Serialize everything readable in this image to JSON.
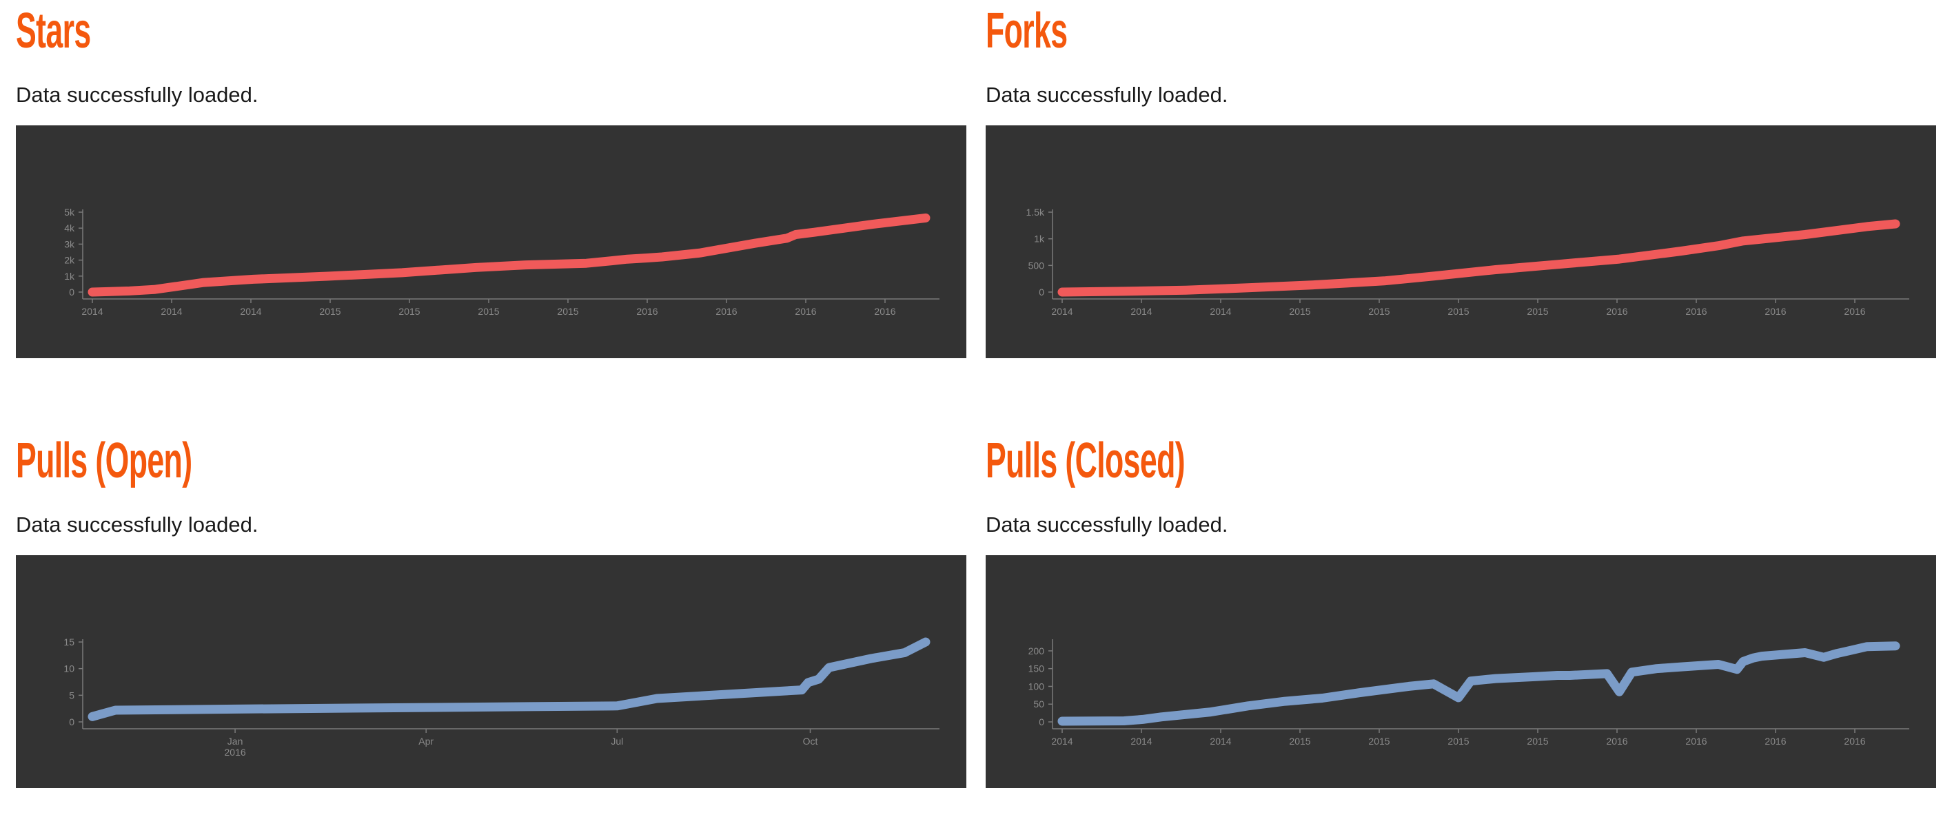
{
  "panels": [
    {
      "id": "stars",
      "title": "Stars",
      "status": "Data successfully loaded.",
      "color": "#f05a5a",
      "chart_data": {
        "type": "line",
        "title": "Stars",
        "xlabel": "",
        "ylabel": "",
        "x_tick_labels": [
          "2014",
          "2014",
          "2014",
          "2015",
          "2015",
          "2015",
          "2015",
          "2016",
          "2016",
          "2016",
          "2016"
        ],
        "y_tick_labels": [
          "0",
          "1k",
          "2k",
          "3k",
          "4k",
          "5k"
        ],
        "y_ticks": [
          0,
          1000,
          2000,
          3000,
          4000,
          5000
        ],
        "ylim": [
          0,
          5000
        ],
        "x": [
          0,
          10,
          30,
          50,
          90,
          130,
          190,
          250,
          310,
          350,
          399,
          420,
          432,
          447,
          460,
          490,
          535,
          561,
          568,
          583,
          630,
          673
        ],
        "y": [
          0,
          20,
          70,
          160,
          600,
          800,
          990,
          1210,
          1540,
          1700,
          1800,
          1960,
          2060,
          2130,
          2200,
          2440,
          3050,
          3370,
          3600,
          3740,
          4240,
          4640
        ],
        "xlim": [
          0,
          673
        ],
        "grid": false,
        "legend": "none"
      }
    },
    {
      "id": "forks",
      "title": "Forks",
      "status": "Data successfully loaded.",
      "color": "#f05a5a",
      "chart_data": {
        "type": "line",
        "title": "Forks",
        "xlabel": "",
        "ylabel": "",
        "x_tick_labels": [
          "2014",
          "2014",
          "2014",
          "2015",
          "2015",
          "2015",
          "2015",
          "2016",
          "2016",
          "2016",
          "2016"
        ],
        "y_tick_labels": [
          "0",
          "500",
          "1k",
          "1.5k"
        ],
        "y_ticks": [
          0,
          500,
          1000,
          1500
        ],
        "ylim": [
          0,
          1500
        ],
        "x": [
          0,
          50,
          100,
          150,
          200,
          230,
          260,
          300,
          350,
          400,
          450,
          500,
          530,
          550,
          600,
          650,
          673
        ],
        "y": [
          0,
          14,
          35,
          80,
          130,
          170,
          210,
          300,
          420,
          520,
          620,
          770,
          870,
          960,
          1080,
          1230,
          1280
        ],
        "xlim": [
          0,
          673
        ],
        "grid": false,
        "legend": "none"
      }
    },
    {
      "id": "pulls-open",
      "title": "Pulls (Open)",
      "status": "Data successfully loaded.",
      "color": "#7b9cc8",
      "chart_data": {
        "type": "line",
        "title": "Pulls (Open)",
        "xlabel": "",
        "ylabel": "",
        "x_tick_labels": [
          "Jan 2016",
          "Apr",
          "Jul",
          "Oct"
        ],
        "y_tick_labels": [
          "0",
          "5",
          "10",
          "15"
        ],
        "y_ticks": [
          0,
          5,
          10,
          15
        ],
        "ylim": [
          0,
          15
        ],
        "x": [
          "2015-10-25",
          "2015-11-05",
          "2016-01-01",
          "2016-04-01",
          "2016-07-01",
          "2016-07-20",
          "2016-09-27",
          "2016-09-30",
          "2016-10-05",
          "2016-10-10",
          "2016-10-30",
          "2016-11-15",
          "2016-11-25"
        ],
        "y": [
          1,
          2.2,
          2.4,
          2.7,
          3.0,
          4.4,
          6.0,
          7.4,
          8.0,
          10.2,
          11.9,
          13.0,
          15.0
        ],
        "grid": false,
        "legend": "none"
      }
    },
    {
      "id": "pulls-closed",
      "title": "Pulls (Closed)",
      "status": "Data successfully loaded.",
      "color": "#7b9cc8",
      "chart_data": {
        "type": "line",
        "title": "Pulls (Closed)",
        "xlabel": "",
        "ylabel": "",
        "x_tick_labels": [
          "2014",
          "2014",
          "2014",
          "2015",
          "2015",
          "2015",
          "2015",
          "2016",
          "2016",
          "2016",
          "2016"
        ],
        "y_tick_labels": [
          "0",
          "50",
          "100",
          "150",
          "200"
        ],
        "y_ticks": [
          0,
          50,
          100,
          150,
          200
        ],
        "ylim": [
          0,
          225
        ],
        "x": [
          0,
          50,
          65,
          80,
          120,
          150,
          180,
          210,
          240,
          280,
          300,
          320,
          330,
          350,
          380,
          400,
          410,
          440,
          450,
          460,
          480,
          500,
          530,
          545,
          550,
          558,
          565,
          600,
          615,
          625,
          635,
          650,
          673
        ],
        "y": [
          2,
          3,
          7,
          14,
          28,
          45,
          58,
          67,
          82,
          100,
          107,
          68,
          115,
          122,
          127,
          131,
          131,
          136,
          85,
          140,
          150,
          155,
          162,
          148,
          170,
          180,
          185,
          195,
          182,
          192,
          200,
          212,
          214
        ],
        "xlim": [
          0,
          673
        ],
        "grid": false,
        "legend": "none"
      }
    }
  ]
}
